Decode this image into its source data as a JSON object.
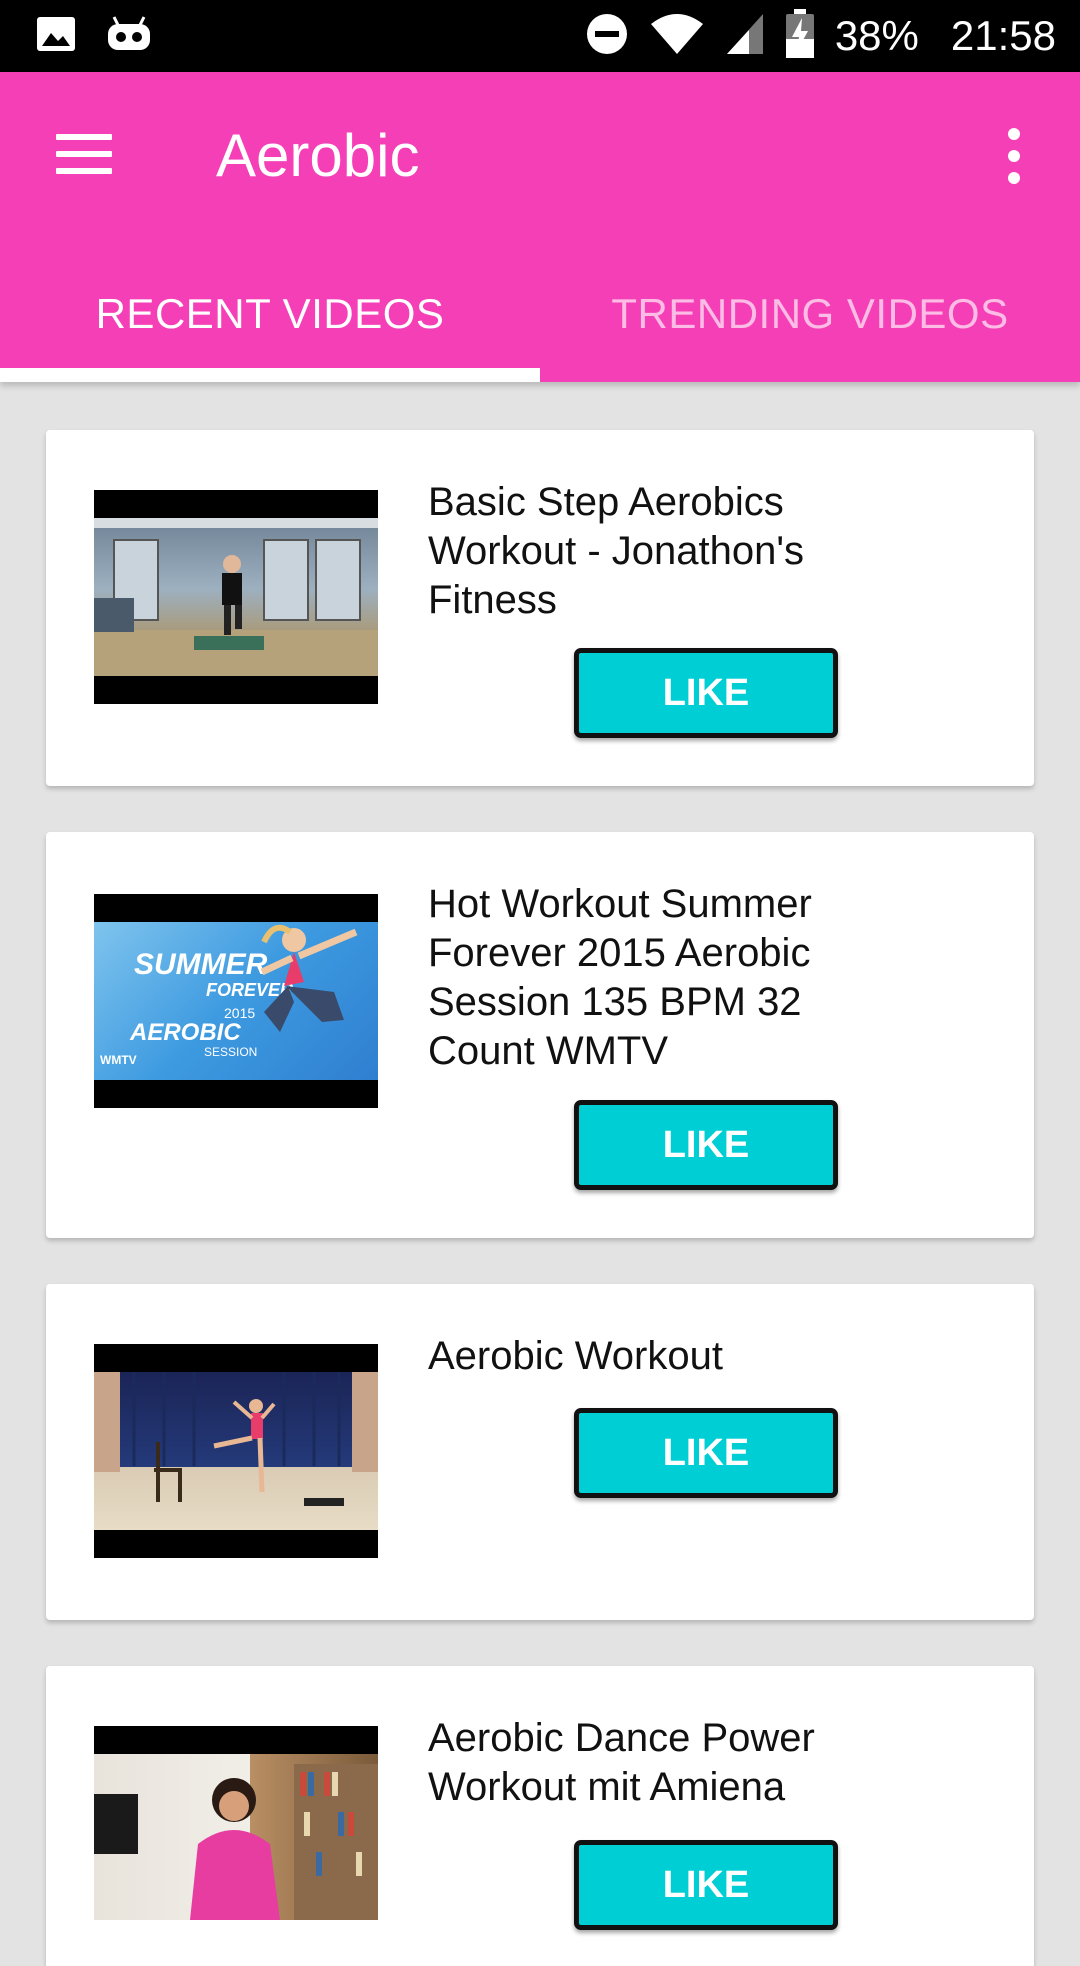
{
  "status_bar": {
    "battery": "38%",
    "time": "21:58"
  },
  "app_bar": {
    "title": "Aerobic",
    "menu_icon": "hamburger-menu-icon",
    "overflow_icon": "more-vertical-icon",
    "background_color": "#f53fb6"
  },
  "tabs": [
    {
      "label": "RECENT VIDEOS",
      "selected": true
    },
    {
      "label": "TRENDING VIDEOS",
      "selected": false
    }
  ],
  "videos": [
    {
      "title": "Basic Step Aerobics Workout - Jonathon's Fitness",
      "like_label": "LIKE"
    },
    {
      "title": "Hot Workout   Summer Forever 2015 Aerobic Session 135 BPM   32 Count   WMTV",
      "like_label": "LIKE",
      "thumb_text": {
        "line1": "SUMMER",
        "line2": "FOREVER",
        "line3": "2015",
        "line4": "AEROBIC",
        "line5": "SESSION",
        "badge": "WMTV"
      }
    },
    {
      "title": "Aerobic Workout",
      "like_label": "LIKE"
    },
    {
      "title": "Aerobic Dance Power Workout mit Amiena",
      "like_label": "LIKE"
    }
  ],
  "colors": {
    "like_button": "#00ced5",
    "background": "#e3e3e3"
  }
}
